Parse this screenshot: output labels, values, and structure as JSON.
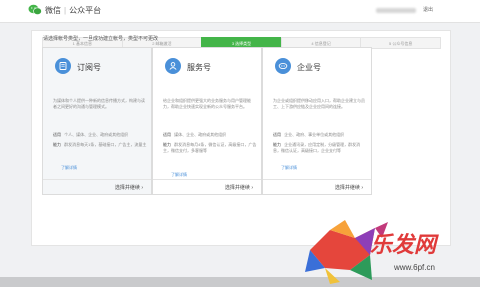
{
  "header": {
    "brand": "微信",
    "product": "公众平台",
    "logout": "退出"
  },
  "steps": [
    {
      "label": "1 基本信息"
    },
    {
      "label": "2 邮箱激活"
    },
    {
      "label": "3 选择类型"
    },
    {
      "label": "4 信息登记"
    },
    {
      "label": "5 公众号信息"
    }
  ],
  "intro": "请选择帐号类型，一旦成功建立帐号，类型不可更改",
  "cards": [
    {
      "title": "订阅号",
      "desc": "为媒体和个人提供一种新的信息传播方式，构建与读者之间更好的沟通与管理模式。",
      "use_label": "适用",
      "use": "个人、媒体、企业、政府或其他组织",
      "ability_label": "能力",
      "ability": "群发消息每天1条，基础接口，广告主，流量主",
      "more": "了解详情",
      "choose": "选择并继续"
    },
    {
      "title": "服务号",
      "desc": "给企业和组织提供更强大的业务服务与用户管理能力，帮助企业快速实现全新的公众号服务平台。",
      "use_label": "适用",
      "use": "媒体、企业、政府或其他组织",
      "ability_label": "能力",
      "ability": "群发消息每月4条，微信认证，高级接口，广告主，微信支付，多客服等",
      "more": "了解详情",
      "choose": "选择并继续"
    },
    {
      "title": "企业号",
      "desc": "为企业或组织提供移动应用入口，帮助企业建立与员工、上下游供应链及企业应用间的连接。",
      "use_label": "适用",
      "use": "企业、政府、事业单位或其他组织",
      "ability_label": "能力",
      "ability": "企业通讯录，应用定制，分级管理，群发消息，微信认证，高级接口，企业支付等",
      "more": "了解详情",
      "choose": "选择并继续"
    }
  ],
  "watermark": {
    "text": "乐发网",
    "url": "www.6pf.cn"
  },
  "colors": {
    "accent": "#44b549",
    "link": "#4a90d9",
    "watermark": "#e03a3a"
  }
}
